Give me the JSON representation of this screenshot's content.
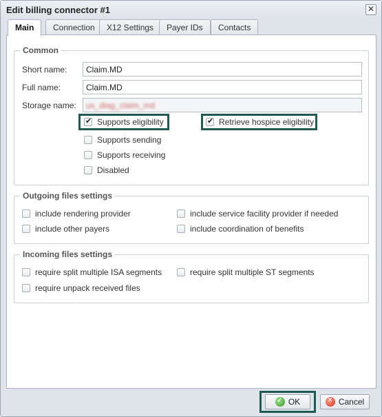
{
  "dialog": {
    "title": "Edit billing connector #1",
    "close_icon": "close-icon",
    "close_glyph": "✕"
  },
  "tabs": [
    {
      "label": "Main",
      "active": true
    },
    {
      "label": "Connection",
      "active": false
    },
    {
      "label": "X12 Settings",
      "active": false
    },
    {
      "label": "Payer IDs",
      "active": false
    },
    {
      "label": "Contacts",
      "active": false
    }
  ],
  "common": {
    "legend": "Common",
    "short_name_label": "Short name:",
    "short_name_value": "Claim.MD",
    "full_name_label": "Full name:",
    "full_name_value": "Claim.MD",
    "storage_name_label": "Storage name:",
    "storage_name_value": "us_diag_claim_md",
    "checkboxes": [
      {
        "label": "Supports eligibility",
        "checked": true
      },
      {
        "label": "Retrieve hospice eligibility",
        "checked": true
      },
      {
        "label": "Supports sending",
        "checked": false
      },
      {
        "label": "Supports receiving",
        "checked": false
      },
      {
        "label": "Disabled",
        "checked": false
      }
    ]
  },
  "outgoing": {
    "legend": "Outgoing files settings",
    "checkboxes": [
      {
        "label": "include rendering provider",
        "checked": false
      },
      {
        "label": "include service facility provider if needed",
        "checked": false
      },
      {
        "label": "include other payers",
        "checked": false
      },
      {
        "label": "include coordination of benefits",
        "checked": false
      }
    ]
  },
  "incoming": {
    "legend": "Incoming files settings",
    "checkboxes": [
      {
        "label": "require split multiple ISA segments",
        "checked": false
      },
      {
        "label": "require split multiple ST segments",
        "checked": false
      },
      {
        "label": "require unpack received files",
        "checked": false
      }
    ]
  },
  "footer": {
    "ok_label": "OK",
    "cancel_label": "Cancel",
    "ok_icon": "check-circle-icon",
    "cancel_icon": "cancel-circle-icon"
  },
  "colors": {
    "highlight": "#1f5a52"
  }
}
